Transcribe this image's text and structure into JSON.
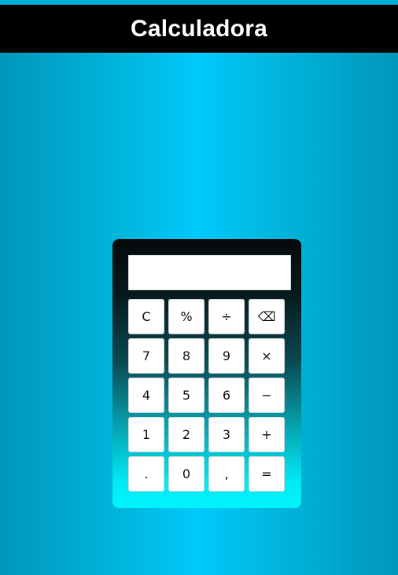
{
  "header": {
    "title": "Calculadora"
  },
  "display": {
    "value": ""
  },
  "keys": [
    {
      "label": "C",
      "name": "clear-button"
    },
    {
      "label": "%",
      "name": "percent-button"
    },
    {
      "label": "÷",
      "name": "divide-button"
    },
    {
      "label": "⌫",
      "name": "backspace-button"
    },
    {
      "label": "7",
      "name": "digit-7-button"
    },
    {
      "label": "8",
      "name": "digit-8-button"
    },
    {
      "label": "9",
      "name": "digit-9-button"
    },
    {
      "label": "×",
      "name": "multiply-button"
    },
    {
      "label": "4",
      "name": "digit-4-button"
    },
    {
      "label": "5",
      "name": "digit-5-button"
    },
    {
      "label": "6",
      "name": "digit-6-button"
    },
    {
      "label": "−",
      "name": "subtract-button"
    },
    {
      "label": "1",
      "name": "digit-1-button"
    },
    {
      "label": "2",
      "name": "digit-2-button"
    },
    {
      "label": "3",
      "name": "digit-3-button"
    },
    {
      "label": "+",
      "name": "add-button"
    },
    {
      "label": ".",
      "name": "dot-button"
    },
    {
      "label": "0",
      "name": "digit-0-button"
    },
    {
      "label": ",",
      "name": "comma-button"
    },
    {
      "label": "=",
      "name": "equals-button"
    }
  ]
}
